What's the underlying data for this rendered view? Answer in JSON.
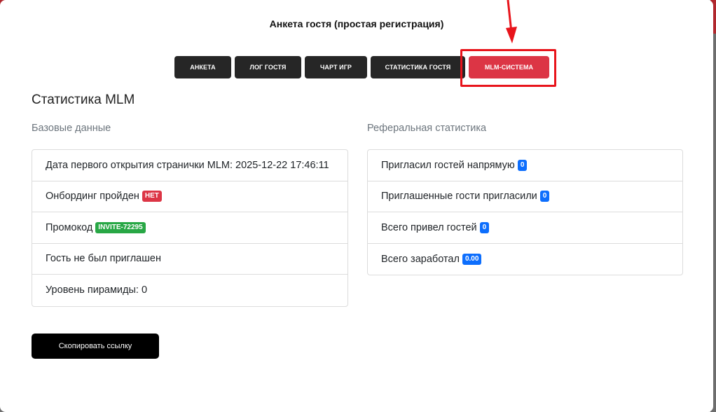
{
  "modal": {
    "title": "Анкета гостя (простая регистрация)"
  },
  "tabs": [
    {
      "label": "АНКЕТА"
    },
    {
      "label": "ЛОГ ГОСТЯ"
    },
    {
      "label": "ЧАРТ ИГР"
    },
    {
      "label": "СТАТИСТИКА ГОСТЯ"
    },
    {
      "label": "MLM-СИСТЕМА",
      "active": true
    }
  ],
  "section": {
    "title": "Статистика MLM"
  },
  "basic": {
    "title": "Базовые данные",
    "first_open": "Дата первого открытия странички MLM: 2025-12-22 17:46:11",
    "onboarding_label": "Онбординг пройден",
    "onboarding_badge": "НЕТ",
    "promo_label": "Промокод",
    "promo_badge": "INVITE-72295",
    "not_invited": "Гость не был приглашен",
    "pyramid_level": "Уровень пирамиды: 0"
  },
  "referral": {
    "title": "Реферальная статистика",
    "items": [
      {
        "label": "Пригласил гостей напрямую",
        "value": "0"
      },
      {
        "label": "Приглашенные гости пригласили",
        "value": "0"
      },
      {
        "label": "Всего привел гостей",
        "value": "0"
      },
      {
        "label": "Всего заработал",
        "value": "0.00"
      }
    ]
  },
  "actions": {
    "copy_link": "Скопировать ссылку"
  },
  "colors": {
    "accent": "#dc3545",
    "success": "#28a745",
    "primary": "#0d6efd",
    "annotation": "#e8141b"
  }
}
